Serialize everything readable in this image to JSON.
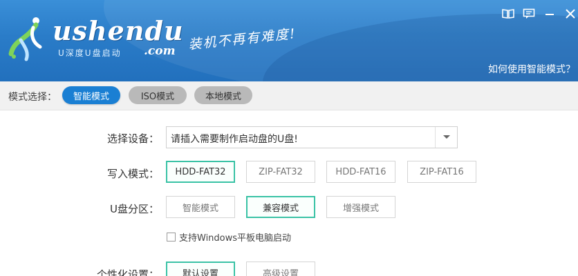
{
  "header": {
    "logo_text": "ushendu",
    "logo_subtext": "U深度U盘启动",
    "logo_com": ".com",
    "slogan": "装机不再有难度!",
    "help_link": "如何使用智能模式？",
    "icons": [
      "book-icon",
      "message-icon",
      "minimize-icon",
      "close-icon"
    ]
  },
  "mode_bar": {
    "label": "模式选择：",
    "modes": [
      {
        "label": "智能模式",
        "active": true
      },
      {
        "label": "ISO模式",
        "active": false
      },
      {
        "label": "本地模式",
        "active": false
      }
    ],
    "active_color": "#1a7fd3"
  },
  "form": {
    "device": {
      "label": "选择设备：",
      "value": "请插入需要制作启动盘的U盘!"
    },
    "write_mode": {
      "label": "写入模式：",
      "options": [
        "HDD-FAT32",
        "ZIP-FAT32",
        "HDD-FAT16",
        "ZIP-FAT16"
      ],
      "selected": "HDD-FAT32"
    },
    "partition": {
      "label": "U盘分区：",
      "options": [
        "智能模式",
        "兼容模式",
        "增强模式"
      ],
      "selected": "兼容模式"
    },
    "windows_tablet": {
      "label": "支持Windows平板电脑启动",
      "checked": false
    },
    "personalize": {
      "label": "个性化设置：",
      "options": [
        "默认设置",
        "高级设置"
      ],
      "selected": "默认设置"
    },
    "selected_color": "#39c2a5"
  }
}
